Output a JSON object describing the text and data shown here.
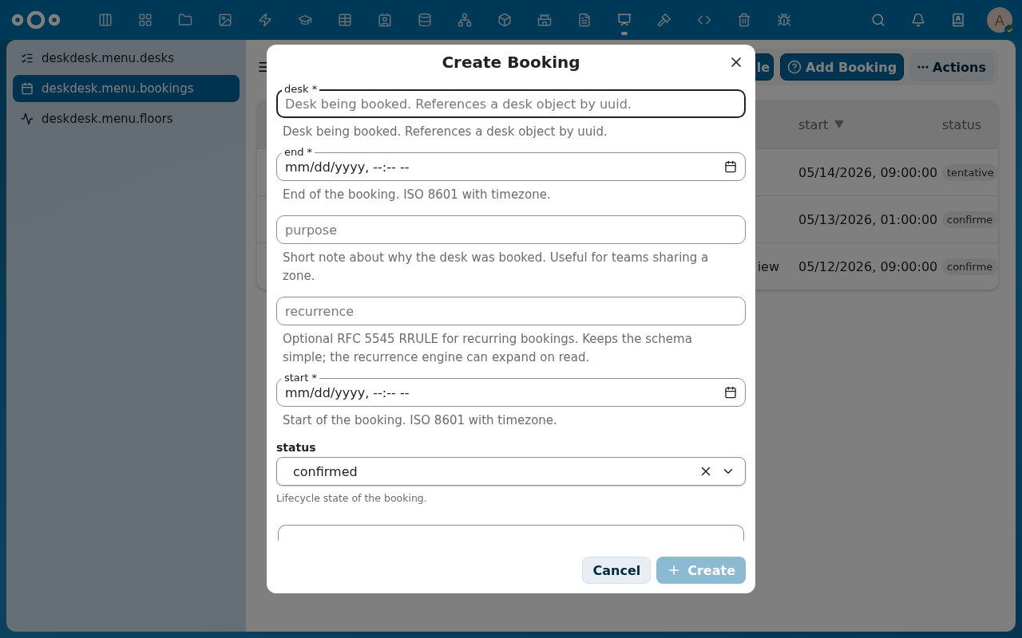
{
  "topbar": {
    "apps": [
      {
        "selected": false
      },
      {
        "selected": false
      },
      {
        "selected": false
      },
      {
        "selected": false
      },
      {
        "selected": false
      },
      {
        "selected": false
      },
      {
        "selected": false
      },
      {
        "selected": false
      },
      {
        "selected": false
      },
      {
        "selected": false
      },
      {
        "selected": false
      },
      {
        "selected": false
      },
      {
        "selected": false
      },
      {
        "selected": true
      },
      {
        "selected": false
      },
      {
        "selected": false
      },
      {
        "selected": false
      },
      {
        "selected": false
      }
    ],
    "avatar": {
      "initial": "A",
      "online": true
    }
  },
  "sidebar": {
    "items": [
      {
        "label": "deskdesk.menu.desks",
        "selected": false
      },
      {
        "label": "deskdesk.menu.bookings",
        "selected": true
      },
      {
        "label": "deskdesk.menu.floors",
        "selected": false
      }
    ]
  },
  "toolbar": {
    "buttons": [
      {
        "label": "le",
        "kind": "primary"
      },
      {
        "label": "Add Booking",
        "kind": "primary"
      },
      {
        "label": "Actions",
        "kind": "secondary"
      }
    ]
  },
  "table": {
    "columns": [
      {
        "label": "start",
        "sorted": true
      },
      {
        "label": "status",
        "sorted": false
      }
    ],
    "rows": [
      {
        "start": "05/14/2026, 09:00:00",
        "status": "tentative"
      },
      {
        "start": "05/13/2026, 01:00:00",
        "status": "confirme"
      },
      {
        "cut_text": "iew",
        "start": "05/12/2026, 09:00:00",
        "status": "confirme"
      }
    ]
  },
  "dialog": {
    "title": "Create Booking",
    "fields": [
      {
        "kind": "text",
        "label": "desk *",
        "placeholder": "Desk being booked. References a desk object by uuid.",
        "focused": true,
        "help": "Desk being booked. References a desk object by uuid."
      },
      {
        "kind": "datetime",
        "label": "end *",
        "value": "mm/dd/yyyy, --:-- --",
        "help": "End of the booking. ISO 8601 with timezone."
      },
      {
        "kind": "text",
        "placeholder": "purpose",
        "focused": false,
        "help": "Short note about why the desk was booked. Useful for teams sharing a zone."
      },
      {
        "kind": "text",
        "placeholder": "recurrence",
        "focused": false,
        "help": "Optional RFC 5545 RRULE for recurring bookings. Keeps the schema simple; the recurrence engine can expand on read."
      },
      {
        "kind": "datetime",
        "label": "start *",
        "value": "mm/dd/yyyy, --:-- --",
        "help": "Start of the booking. ISO 8601 with timezone."
      },
      {
        "kind": "select",
        "label": "status",
        "value": "confirmed",
        "help": "Lifecycle state of the booking."
      },
      {
        "kind": "partial"
      }
    ],
    "buttons": [
      {
        "label": "Cancel",
        "kind": "secondary",
        "disabled": false
      },
      {
        "label": "Create",
        "kind": "primary",
        "disabled": true
      }
    ]
  }
}
